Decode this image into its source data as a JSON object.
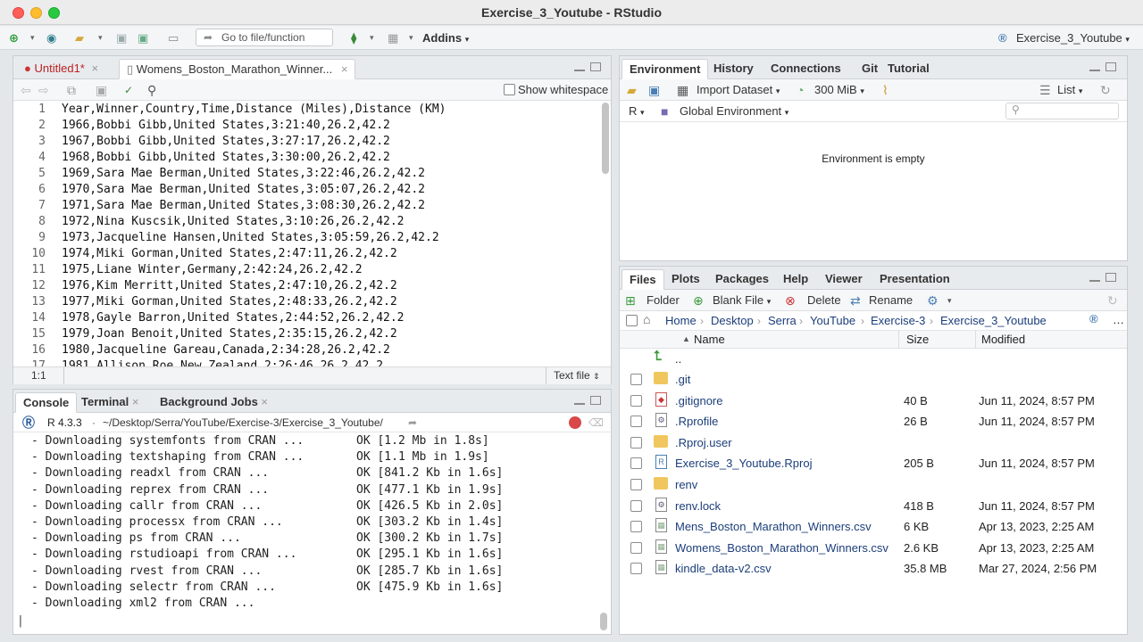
{
  "window": {
    "title": "Exercise_3_Youtube - RStudio"
  },
  "toolbar": {
    "go_to_file": "Go to file/function",
    "addins": "Addins",
    "project": "Exercise_3_Youtube"
  },
  "editor": {
    "tabs": [
      {
        "label": "Untitled1*",
        "modified": true
      },
      {
        "label": "Womens_Boston_Marathon_Winner..."
      }
    ],
    "show_whitespace": "Show whitespace",
    "cursor_pos": "1:1",
    "file_type": "Text file",
    "lines": [
      {
        "n": "1",
        "text": "Year,Winner,Country,Time,Distance (Miles),Distance (KM)"
      },
      {
        "n": "2",
        "text": "1966,Bobbi Gibb,United States,3:21:40,26.2,42.2"
      },
      {
        "n": "3",
        "text": "1967,Bobbi Gibb,United States,3:27:17,26.2,42.2"
      },
      {
        "n": "4",
        "text": "1968,Bobbi Gibb,United States,3:30:00,26.2,42.2"
      },
      {
        "n": "5",
        "text": "1969,Sara Mae Berman,United States,3:22:46,26.2,42.2"
      },
      {
        "n": "6",
        "text": "1970,Sara Mae Berman,United States,3:05:07,26.2,42.2"
      },
      {
        "n": "7",
        "text": "1971,Sara Mae Berman,United States,3:08:30,26.2,42.2"
      },
      {
        "n": "8",
        "text": "1972,Nina Kuscsik,United States,3:10:26,26.2,42.2"
      },
      {
        "n": "9",
        "text": "1973,Jacqueline Hansen,United States,3:05:59,26.2,42.2"
      },
      {
        "n": "10",
        "text": "1974,Miki Gorman,United States,2:47:11,26.2,42.2"
      },
      {
        "n": "11",
        "text": "1975,Liane Winter,Germany,2:42:24,26.2,42.2"
      },
      {
        "n": "12",
        "text": "1976,Kim Merritt,United States,2:47:10,26.2,42.2"
      },
      {
        "n": "13",
        "text": "1977,Miki Gorman,United States,2:48:33,26.2,42.2"
      },
      {
        "n": "14",
        "text": "1978,Gayle Barron,United States,2:44:52,26.2,42.2"
      },
      {
        "n": "15",
        "text": "1979,Joan Benoit,United States,2:35:15,26.2,42.2"
      },
      {
        "n": "16",
        "text": "1980,Jacqueline Gareau,Canada,2:34:28,26.2,42.2"
      },
      {
        "n": "17",
        "text": "1981,Allison Roe,New Zealand,2:26:46,26.2,42.2"
      }
    ]
  },
  "console": {
    "tabs": [
      "Console",
      "Terminal",
      "Background Jobs"
    ],
    "r_version": "R 4.3.3",
    "path": "~/Desktop/Serra/YouTube/Exercise-3/Exercise_3_Youtube/",
    "lines": [
      {
        "text": "- Downloading systemfonts from CRAN ...",
        "status": "OK [1.2 Mb in 1.8s]"
      },
      {
        "text": "- Downloading textshaping from CRAN ...",
        "status": "OK [1.1 Mb in 1.9s]"
      },
      {
        "text": "- Downloading readxl from CRAN ...",
        "status": "OK [841.2 Kb in 1.6s]"
      },
      {
        "text": "- Downloading reprex from CRAN ...",
        "status": "OK [477.1 Kb in 1.9s]"
      },
      {
        "text": "- Downloading callr from CRAN ...",
        "status": "OK [426.5 Kb in 2.0s]"
      },
      {
        "text": "- Downloading processx from CRAN ...",
        "status": "OK [303.2 Kb in 1.4s]"
      },
      {
        "text": "- Downloading ps from CRAN ...",
        "status": "OK [300.2 Kb in 1.7s]"
      },
      {
        "text": "- Downloading rstudioapi from CRAN ...",
        "status": "OK [295.1 Kb in 1.6s]"
      },
      {
        "text": "- Downloading rvest from CRAN ...",
        "status": "OK [285.7 Kb in 1.6s]"
      },
      {
        "text": "- Downloading selectr from CRAN ...",
        "status": "OK [475.9 Kb in 1.6s]"
      },
      {
        "text": "- Downloading xml2 from CRAN ...",
        "status": ""
      }
    ]
  },
  "env": {
    "tabs": [
      "Environment",
      "History",
      "Connections",
      "Git",
      "Tutorial"
    ],
    "import_dataset": "Import Dataset",
    "memory": "300 MiB",
    "view_mode": "List",
    "language": "R",
    "scope": "Global Environment",
    "empty_msg": "Environment is empty"
  },
  "files": {
    "tabs": [
      "Files",
      "Plots",
      "Packages",
      "Help",
      "Viewer",
      "Presentation"
    ],
    "toolbar": {
      "folder": "Folder",
      "blank_file": "Blank File",
      "delete": "Delete",
      "rename": "Rename"
    },
    "breadcrumb": [
      "Home",
      "Desktop",
      "Serra",
      "YouTube",
      "Exercise-3",
      "Exercise_3_Youtube"
    ],
    "columns": {
      "name": "Name",
      "size": "Size",
      "modified": "Modified"
    },
    "parent": "..",
    "rows": [
      {
        "name": ".git",
        "size": "",
        "modified": "",
        "icon": "folder-icon"
      },
      {
        "name": ".gitignore",
        "size": "40 B",
        "modified": "Jun 11, 2024, 8:57 PM",
        "icon": "gitignore-icon"
      },
      {
        "name": ".Rprofile",
        "size": "26 B",
        "modified": "Jun 11, 2024, 8:57 PM",
        "icon": "gear-file-icon"
      },
      {
        "name": ".Rproj.user",
        "size": "",
        "modified": "",
        "icon": "folder-icon"
      },
      {
        "name": "Exercise_3_Youtube.Rproj",
        "size": "205 B",
        "modified": "Jun 11, 2024, 8:57 PM",
        "icon": "rproj-icon"
      },
      {
        "name": "renv",
        "size": "",
        "modified": "",
        "icon": "folder-icon"
      },
      {
        "name": "renv.lock",
        "size": "418 B",
        "modified": "Jun 11, 2024, 8:57 PM",
        "icon": "gear-file-icon"
      },
      {
        "name": "Mens_Boston_Marathon_Winners.csv",
        "size": "6 KB",
        "modified": "Apr 13, 2023, 2:25 AM",
        "icon": "csv-icon"
      },
      {
        "name": "Womens_Boston_Marathon_Winners.csv",
        "size": "2.6 KB",
        "modified": "Apr 13, 2023, 2:25 AM",
        "icon": "csv-icon"
      },
      {
        "name": "kindle_data-v2.csv",
        "size": "35.8 MB",
        "modified": "Mar 27, 2024, 2:56 PM",
        "icon": "csv-icon"
      }
    ]
  }
}
